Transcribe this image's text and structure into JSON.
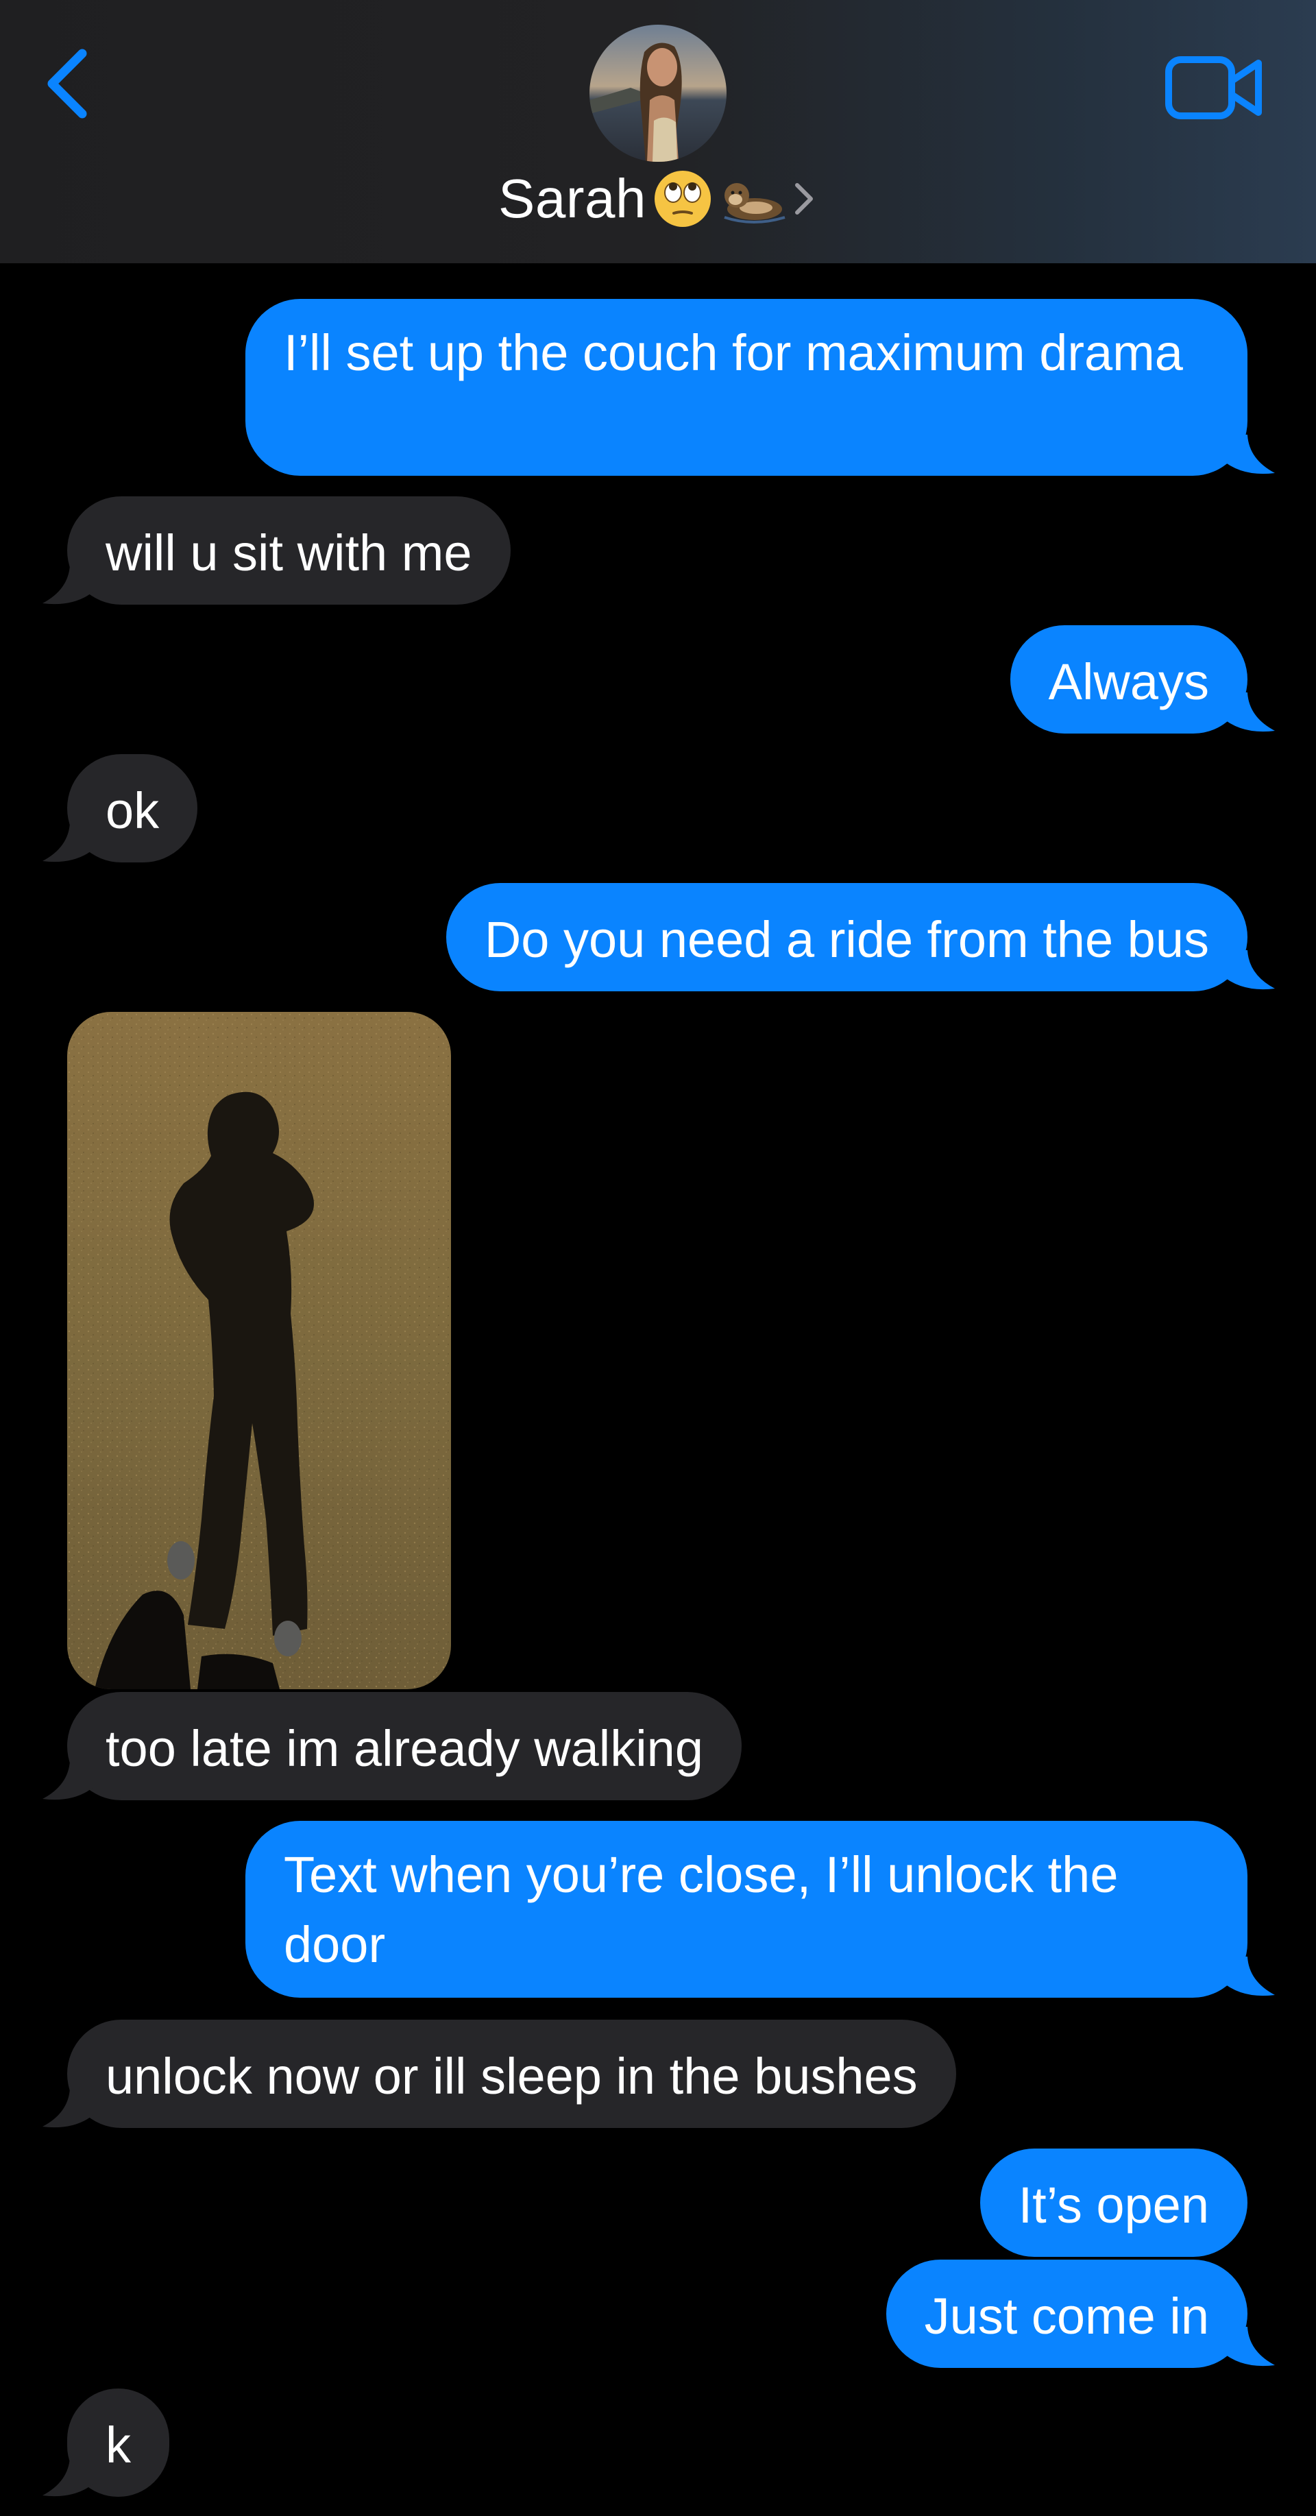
{
  "header": {
    "contact_name": "Sarah",
    "name_emojis": [
      "face-with-rolling-eyes",
      "otter"
    ],
    "back_icon": "chevron-left-icon",
    "video_icon": "video-camera-icon",
    "accent_color": "#0a84ff"
  },
  "messages": [
    {
      "from": "me",
      "text": "I’ll set up the couch for maximum drama"
    },
    {
      "from": "them",
      "text": "will u sit with me"
    },
    {
      "from": "me",
      "text": "Always"
    },
    {
      "from": "them",
      "text": "ok"
    },
    {
      "from": "me",
      "text": "Do you need a ride from the bus"
    },
    {
      "from": "them",
      "type": "photo",
      "alt": "shadow photo"
    },
    {
      "from": "them",
      "text": "too late im already walking"
    },
    {
      "from": "me",
      "text": "Text when you’re close, I’ll unlock the door"
    },
    {
      "from": "them",
      "text": "unlock now or ill sleep in the bushes"
    },
    {
      "from": "me",
      "text": "It’s open"
    },
    {
      "from": "me",
      "text": "Just come in"
    },
    {
      "from": "them",
      "text": "k"
    }
  ],
  "colors": {
    "sent_bubble": "#0a84ff",
    "received_bubble": "#262629",
    "background": "#000000"
  }
}
